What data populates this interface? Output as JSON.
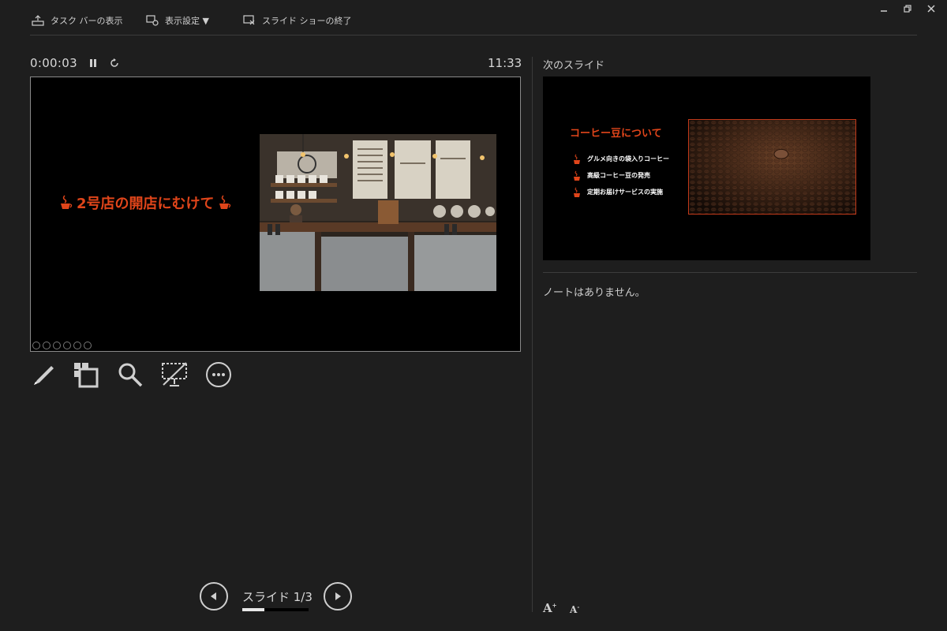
{
  "toolbar": {
    "taskbar_label": "タスク バーの表示",
    "display_settings_label": "表示設定 ▼",
    "end_show_label": "スライド ショーの終了"
  },
  "window_controls": {
    "minimize": "minimize-icon",
    "restore": "restore-icon",
    "close": "close-icon"
  },
  "timer": {
    "elapsed": "0:00:03",
    "clock": "11:33"
  },
  "current_slide": {
    "title": "2号店の開店にむけて",
    "accent_color": "#e0451a"
  },
  "tools": [
    "pen-icon",
    "slides-grid-icon",
    "zoom-icon",
    "black-screen-icon",
    "more-icon"
  ],
  "next_slide": {
    "label": "次のスライド",
    "title": "コーヒー豆について",
    "bullets": [
      "グルメ向きの袋入りコーヒー",
      "高級コーヒー豆の発売",
      "定期お届けサービスの実施"
    ]
  },
  "notes": {
    "text": "ノートはありません。"
  },
  "navigator": {
    "label": "スライド 1/3",
    "progress": 0.333
  }
}
